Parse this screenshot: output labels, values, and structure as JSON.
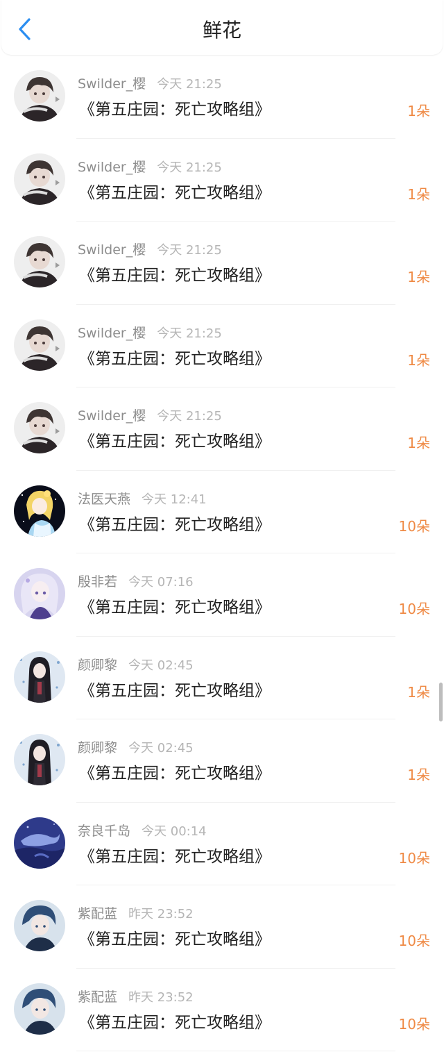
{
  "header": {
    "title": "鲜花",
    "back_icon": "chevron-left-icon",
    "accent_color": "#2b8ef1"
  },
  "colors": {
    "count": "#ef8a45",
    "name": "#8d8d8d",
    "time": "#b5b5b5"
  },
  "items": [
    {
      "user": "Swilder_樱",
      "time": "今天 21:25",
      "book": "《第五庄园：死亡攻略组》",
      "count": "1朵",
      "avatar": "dark-hair-boy"
    },
    {
      "user": "Swilder_樱",
      "time": "今天 21:25",
      "book": "《第五庄园：死亡攻略组》",
      "count": "1朵",
      "avatar": "dark-hair-boy"
    },
    {
      "user": "Swilder_樱",
      "time": "今天 21:25",
      "book": "《第五庄园：死亡攻略组》",
      "count": "1朵",
      "avatar": "dark-hair-boy"
    },
    {
      "user": "Swilder_樱",
      "time": "今天 21:25",
      "book": "《第五庄园：死亡攻略组》",
      "count": "1朵",
      "avatar": "dark-hair-boy"
    },
    {
      "user": "Swilder_樱",
      "time": "今天 21:25",
      "book": "《第五庄园：死亡攻略组》",
      "count": "1朵",
      "avatar": "dark-hair-boy"
    },
    {
      "user": "法医天燕",
      "time": "今天 12:41",
      "book": "《第五庄园：死亡攻略组》",
      "count": "10朵",
      "avatar": "blonde-girl"
    },
    {
      "user": "殷非若",
      "time": "今天 07:16",
      "book": "《第五庄园：死亡攻略组》",
      "count": "10朵",
      "avatar": "silver-hair-girl"
    },
    {
      "user": "颜卿黎",
      "time": "今天 02:45",
      "book": "《第五庄园：死亡攻略组》",
      "count": "1朵",
      "avatar": "black-hair-girl"
    },
    {
      "user": "颜卿黎",
      "time": "今天 02:45",
      "book": "《第五庄园：死亡攻略组》",
      "count": "1朵",
      "avatar": "black-hair-girl"
    },
    {
      "user": "奈良千岛",
      "time": "今天 00:14",
      "book": "《第五庄园：死亡攻略组》",
      "count": "10朵",
      "avatar": "blue-whale"
    },
    {
      "user": "紫配蓝",
      "time": "昨天 23:52",
      "book": "《第五庄园：死亡攻略组》",
      "count": "10朵",
      "avatar": "blue-hair-boy"
    },
    {
      "user": "紫配蓝",
      "time": "昨天 23:52",
      "book": "《第五庄园：死亡攻略组》",
      "count": "10朵",
      "avatar": "blue-hair-boy"
    }
  ]
}
